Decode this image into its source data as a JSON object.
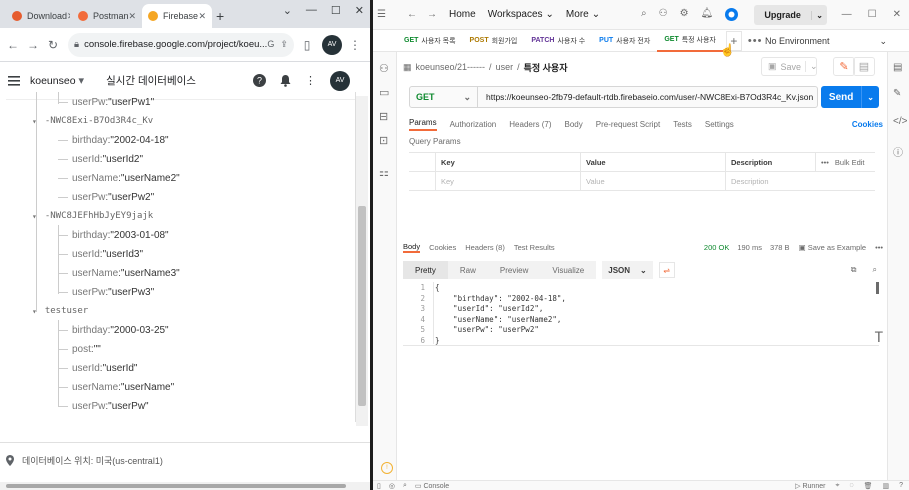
{
  "browser": {
    "tabs": [
      {
        "label": "Download",
        "favicon_color": "#e65c2e"
      },
      {
        "label": "Postman",
        "favicon_color": "#f26b3a"
      },
      {
        "label": "Firebase",
        "favicon_color": "#f5a623"
      }
    ],
    "url": "console.firebase.google.com/project/koeu...",
    "omnibox_icons": [
      "google-icon",
      "share-icon",
      "star-icon",
      "sidepanel-icon",
      "profile-icon"
    ]
  },
  "firebase": {
    "project": "koeunseo",
    "section_title": "실시간 데이터베이스",
    "tree": [
      {
        "key": "userPw",
        "value": "\"userPw1\""
      },
      {
        "node": "-NWC8Exi-B7Od3R4c_Kv"
      },
      {
        "key": "birthday",
        "value": "\"2002-04-18\""
      },
      {
        "key": "userId",
        "value": "\"userId2\""
      },
      {
        "key": "userName",
        "value": "\"userName2\""
      },
      {
        "key": "userPw",
        "value": "\"userPw2\""
      },
      {
        "node": "-NWC8JEFhHbJyEY9jajk"
      },
      {
        "key": "birthday",
        "value": "\"2003-01-08\""
      },
      {
        "key": "userId",
        "value": "\"userId3\""
      },
      {
        "key": "userName",
        "value": "\"userName3\""
      },
      {
        "key": "userPw",
        "value": "\"userPw3\""
      },
      {
        "node": "testuser"
      },
      {
        "key": "birthday",
        "value": "\"2000-03-25\""
      },
      {
        "key": "post",
        "value": "\"\""
      },
      {
        "key": "userId",
        "value": "\"userId\""
      },
      {
        "key": "userName",
        "value": "\"userName\""
      },
      {
        "key": "userPw",
        "value": "\"userPw\""
      }
    ],
    "footer_location": "데이터베이스 위치: 미국(us-central1)"
  },
  "postman": {
    "nav": {
      "home": "Home",
      "workspaces": "Workspaces",
      "more": "More",
      "upgrade": "Upgrade"
    },
    "tabs": [
      {
        "method": "GET",
        "name": "사용자 목록",
        "method_color": "#0f8a2f"
      },
      {
        "method": "POST",
        "name": "회원가입",
        "method_color": "#ad7a03"
      },
      {
        "method": "PATCH",
        "name": "사용자 수",
        "method_color": "#623497"
      },
      {
        "method": "PUT",
        "name": "사용자 전자",
        "method_color": "#097bed"
      },
      {
        "method": "GET",
        "name": "특정 사용자",
        "method_color": "#0f8a2f"
      }
    ],
    "environment": "No Environment",
    "breadcrumb": {
      "collection": "koeunseo/21------",
      "folder": "user",
      "request": "특정 사용자"
    },
    "save_label": "Save",
    "method": "GET",
    "url": "https://koeunseo-2fb79-default-rtdb.firebaseio.com/user/-NWC8Exi-B7Od3R4c_Kv.json",
    "send_label": "Send",
    "request_tabs": [
      "Params",
      "Authorization",
      "Headers (7)",
      "Body",
      "Pre-request Script",
      "Tests",
      "Settings"
    ],
    "cookies_label": "Cookies",
    "query_params_label": "Query Params",
    "params_headers": [
      "Key",
      "Value",
      "Description"
    ],
    "params_placeholders": [
      "Key",
      "Value",
      "Description"
    ],
    "bulk_edit": "Bulk Edit",
    "response_tabs": [
      "Body",
      "Cookies",
      "Headers (8)",
      "Test Results"
    ],
    "status": "200 OK",
    "time": "190 ms",
    "size": "378 B",
    "save_example": "Save as Example",
    "view_modes": [
      "Pretty",
      "Raw",
      "Preview",
      "Visualize"
    ],
    "format": "JSON",
    "response_lines": [
      "{",
      "    \"birthday\": \"2002-04-18\",",
      "    \"userId\": \"userId2\",",
      "    \"userName\": \"userName2\",",
      "    \"userPw\": \"userPw2\"",
      "}"
    ],
    "status_bar": {
      "console": "Console",
      "runner": "Runner"
    }
  }
}
